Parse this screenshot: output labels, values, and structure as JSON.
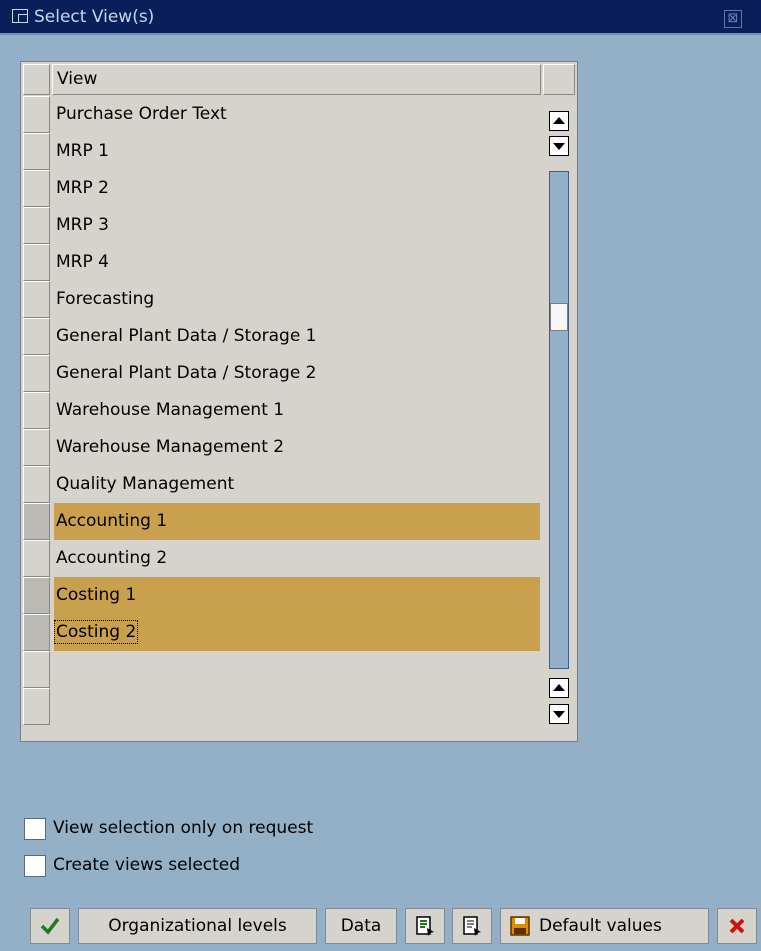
{
  "dialog": {
    "title": "Select View(s)"
  },
  "table": {
    "header": "View",
    "rows": [
      {
        "label": "Purchase Order Text",
        "selected": false
      },
      {
        "label": "MRP 1",
        "selected": false
      },
      {
        "label": "MRP 2",
        "selected": false
      },
      {
        "label": "MRP 3",
        "selected": false
      },
      {
        "label": "MRP 4",
        "selected": false
      },
      {
        "label": "Forecasting",
        "selected": false
      },
      {
        "label": "General Plant Data / Storage 1",
        "selected": false
      },
      {
        "label": "General Plant Data / Storage 2",
        "selected": false
      },
      {
        "label": "Warehouse Management 1",
        "selected": false
      },
      {
        "label": "Warehouse Management 2",
        "selected": false
      },
      {
        "label": "Quality Management",
        "selected": false
      },
      {
        "label": "Accounting 1",
        "selected": true
      },
      {
        "label": "Accounting 2",
        "selected": false
      },
      {
        "label": "Costing 1",
        "selected": true
      },
      {
        "label": "Costing 2",
        "selected": true,
        "focused": true
      },
      {
        "label": "",
        "selected": false
      },
      {
        "label": "",
        "selected": false
      }
    ]
  },
  "options": {
    "view_selection_only_on_request": {
      "label": "View selection only on request",
      "checked": false
    },
    "create_views_selected": {
      "label": "Create views selected",
      "checked": false
    }
  },
  "toolbar": {
    "org_levels": "Organizational levels",
    "data": "Data",
    "default_values": "Default values"
  },
  "colors": {
    "selected_row": "#c8a04e",
    "background": "#93b0c6",
    "titlebar": "#0a1f5a"
  }
}
